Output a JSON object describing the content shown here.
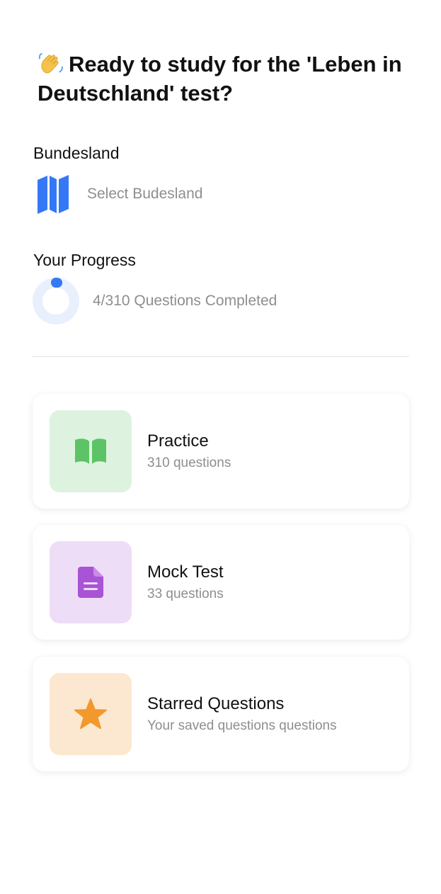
{
  "header": {
    "title": "Ready to study for the 'Leben in Deutschland' test?",
    "wave_icon": "waving-hand-icon"
  },
  "bundesland": {
    "label": "Bundesland",
    "placeholder": "Select Budesland",
    "icon": "map-icon",
    "icon_color": "#3478F6"
  },
  "progress": {
    "label": "Your Progress",
    "text": "4/310 Questions Completed",
    "completed": 4,
    "total": 310,
    "ring_color": "#3478F6",
    "ring_track_color": "#E8F0FD"
  },
  "cards": [
    {
      "title": "Practice",
      "subtitle": "310 questions",
      "icon": "book-icon",
      "icon_color": "#5CC466",
      "tile_color": "#DDF3E0"
    },
    {
      "title": "Mock Test",
      "subtitle": "33 questions",
      "icon": "document-icon",
      "icon_color": "#A953D6",
      "tile_color": "#EEDDF6"
    },
    {
      "title": "Starred Questions",
      "subtitle": "Your saved questions questions",
      "icon": "star-icon",
      "icon_color": "#F2992E",
      "tile_color": "#FCE8D0"
    }
  ]
}
